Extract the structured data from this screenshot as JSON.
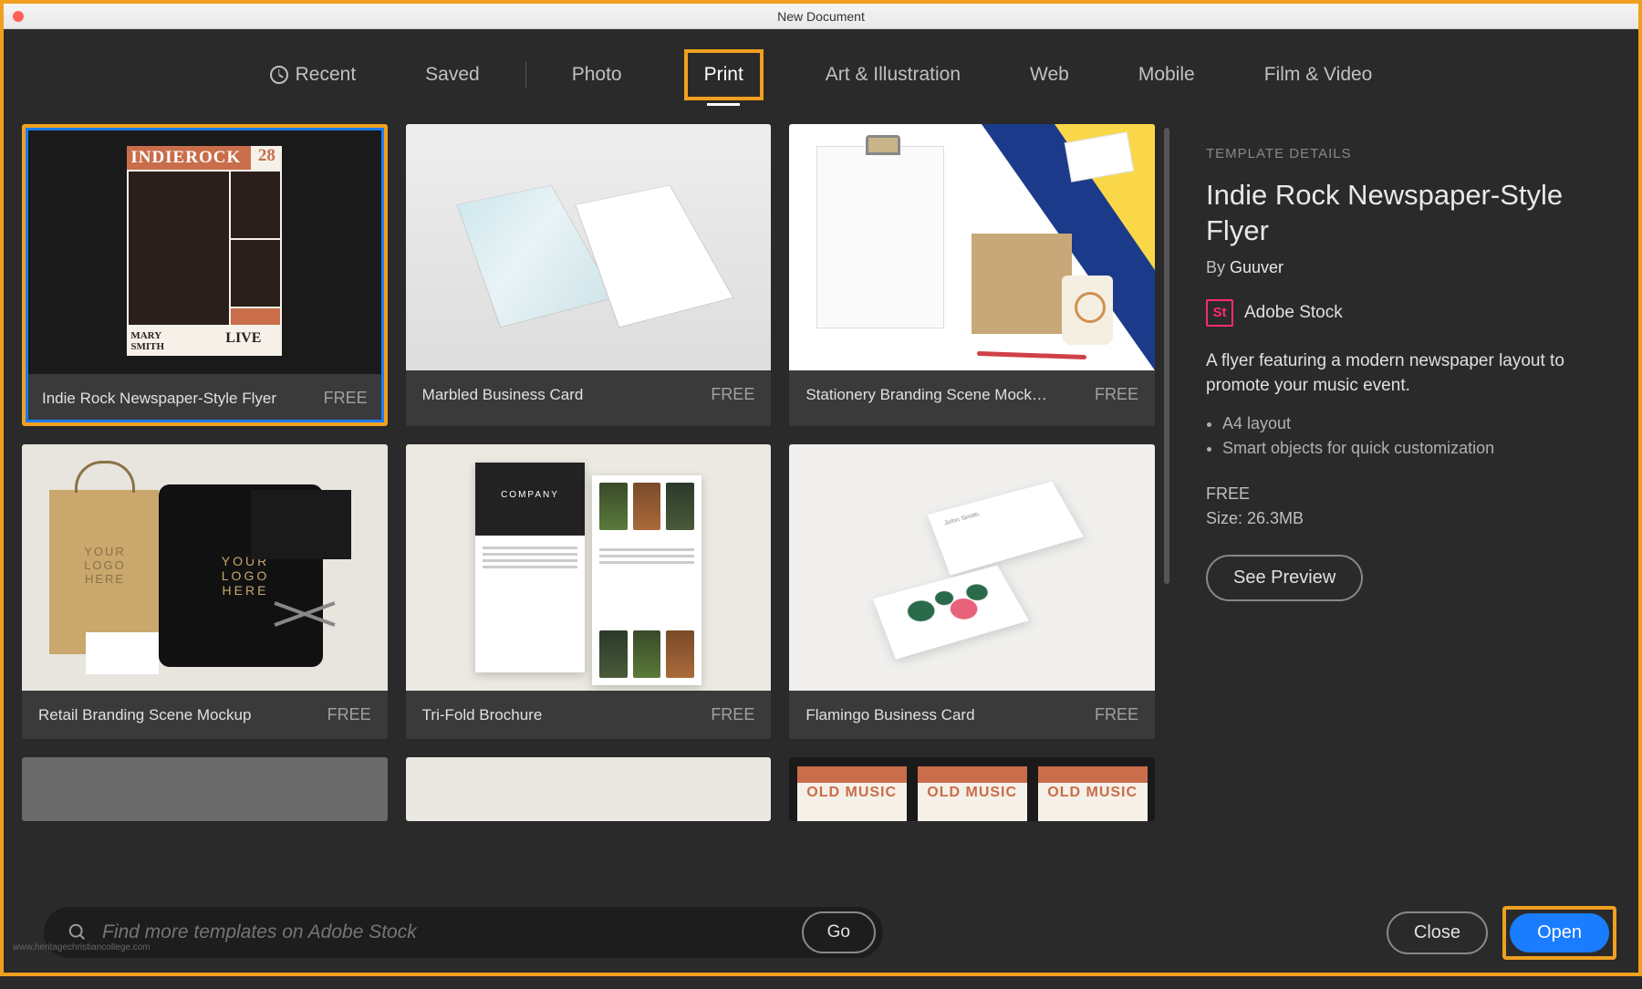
{
  "window_title": "New Document",
  "tabs": [
    {
      "id": "recent",
      "label": "Recent"
    },
    {
      "id": "saved",
      "label": "Saved"
    },
    {
      "id": "photo",
      "label": "Photo"
    },
    {
      "id": "print",
      "label": "Print"
    },
    {
      "id": "art",
      "label": "Art & Illustration"
    },
    {
      "id": "web",
      "label": "Web"
    },
    {
      "id": "mobile",
      "label": "Mobile"
    },
    {
      "id": "film",
      "label": "Film & Video"
    }
  ],
  "active_tab": "print",
  "templates": [
    {
      "title": "Indie Rock Newspaper-Style Flyer",
      "price": "FREE",
      "selected": true
    },
    {
      "title": "Marbled Business Card",
      "price": "FREE",
      "selected": false
    },
    {
      "title": "Stationery Branding Scene Mock…",
      "price": "FREE",
      "selected": false
    },
    {
      "title": "Retail Branding Scene Mockup",
      "price": "FREE",
      "selected": false
    },
    {
      "title": "Tri-Fold Brochure",
      "price": "FREE",
      "selected": false
    },
    {
      "title": "Flamingo Business Card",
      "price": "FREE",
      "selected": false
    }
  ],
  "indie_poster": {
    "brand": "INDIEROCK",
    "date_num": "28",
    "name_line1": "MARY",
    "name_line2": "SMITH",
    "live": "LIVE"
  },
  "retail": {
    "bag_text": "YOUR LOGO HERE",
    "shirt_text": "YOUR LOGO HERE"
  },
  "trifold": {
    "company": "COMPANY"
  },
  "oldmusic_label": "OLD MUSIC",
  "details": {
    "label": "TEMPLATE DETAILS",
    "title": "Indie Rock Newspaper-Style Flyer",
    "by_prefix": "By ",
    "author": "Guuver",
    "stock_badge": "St",
    "stock_label": "Adobe Stock",
    "description": "A flyer featuring a modern newspaper layout to promote your music event.",
    "bullets": [
      "A4 layout",
      "Smart objects for quick customization"
    ],
    "price": "FREE",
    "size_label": "Size: 26.3MB",
    "preview_btn": "See Preview"
  },
  "search": {
    "placeholder": "Find more templates on Adobe Stock",
    "go": "Go"
  },
  "actions": {
    "close": "Close",
    "open": "Open"
  },
  "watermark": "www.heritagechristiancollege.com"
}
